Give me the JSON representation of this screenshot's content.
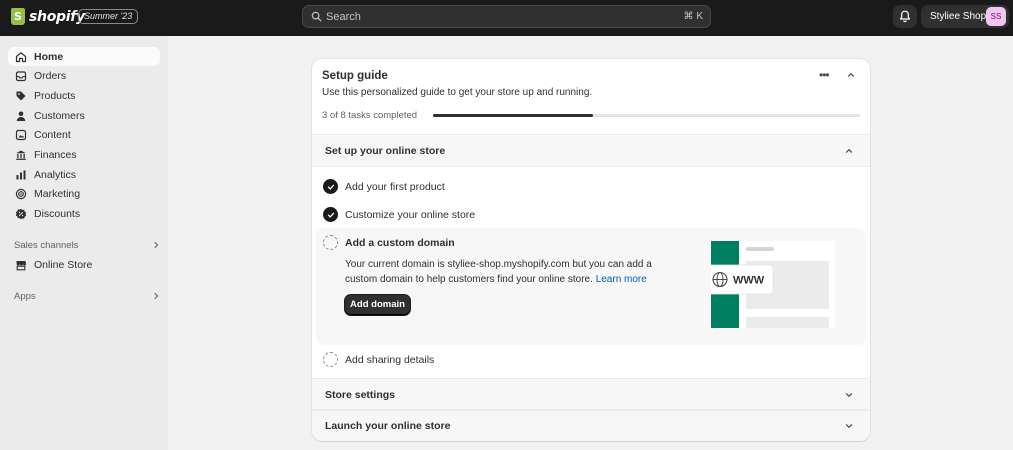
{
  "topbar": {
    "brand": "shopify",
    "edition_badge": "Summer '23",
    "search": {
      "placeholder": "Search",
      "shortcut": "⌘ K"
    },
    "store": {
      "name": "Styliee Shop",
      "initials": "SS"
    },
    "icons": {
      "search": "search-icon",
      "bell": "bell-icon"
    }
  },
  "sidebar": {
    "items": [
      {
        "label": "Home",
        "icon": "home-icon",
        "active": true
      },
      {
        "label": "Orders",
        "icon": "orders-icon"
      },
      {
        "label": "Products",
        "icon": "tag-icon"
      },
      {
        "label": "Customers",
        "icon": "person-icon"
      },
      {
        "label": "Content",
        "icon": "content-icon"
      },
      {
        "label": "Finances",
        "icon": "bank-icon"
      },
      {
        "label": "Analytics",
        "icon": "analytics-icon"
      },
      {
        "label": "Marketing",
        "icon": "target-icon"
      },
      {
        "label": "Discounts",
        "icon": "discount-icon"
      }
    ],
    "sales_channels": {
      "heading": "Sales channels",
      "items": [
        {
          "label": "Online Store",
          "icon": "store-icon"
        }
      ]
    },
    "apps": {
      "heading": "Apps"
    }
  },
  "setup_guide": {
    "title": "Setup guide",
    "subtitle": "Use this personalized guide to get your store up and running.",
    "progress": {
      "text": "3 of 8 tasks completed",
      "completed": 3,
      "total": 8
    },
    "sections": [
      {
        "title": "Set up your online store",
        "expanded": true,
        "tasks": [
          {
            "label": "Add your first product",
            "done": true
          },
          {
            "label": "Customize your online store",
            "done": true
          },
          {
            "label": "Add a custom domain",
            "done": false,
            "active": true,
            "description": "Your current domain is styliee-shop.myshopify.com but you can add a custom domain to help customers find your online store.",
            "link": "Learn more",
            "button": "Add domain",
            "illustration_text": "WWW"
          },
          {
            "label": "Add sharing details",
            "done": false
          }
        ]
      },
      {
        "title": "Store settings",
        "expanded": false
      },
      {
        "title": "Launch your online store",
        "expanded": false
      }
    ]
  },
  "colors": {
    "topbar": "#1a1a1a",
    "sidebar": "#ebebeb",
    "page": "#f1f1f1",
    "brand_green": "#008060",
    "link": "#005bd3",
    "avatar": "#f4c3f0"
  }
}
